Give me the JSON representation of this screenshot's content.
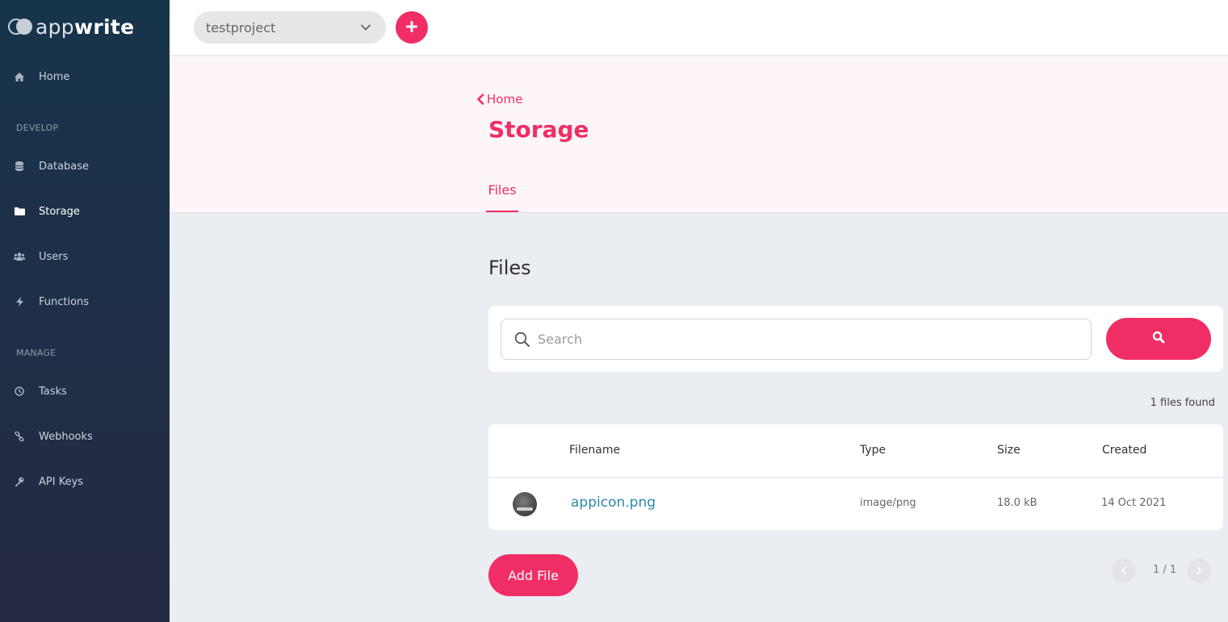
{
  "sidebar": {
    "logo": {
      "text_light": "app",
      "text_bold": "write"
    },
    "items": [
      {
        "label": "Home",
        "icon": "home-icon"
      },
      {
        "label": "Database",
        "icon": "database-icon"
      },
      {
        "label": "Storage",
        "icon": "folder-icon"
      },
      {
        "label": "Users",
        "icon": "users-icon"
      },
      {
        "label": "Functions",
        "icon": "bolt-icon"
      },
      {
        "label": "Tasks",
        "icon": "clock-icon"
      },
      {
        "label": "Webhooks",
        "icon": "link-icon"
      },
      {
        "label": "API Keys",
        "icon": "key-icon"
      }
    ],
    "sections": {
      "develop": "DEVELOP",
      "manage": "MANAGE"
    },
    "active": "Storage"
  },
  "header": {
    "project": "testproject"
  },
  "page": {
    "back_label": "Home",
    "title": "Storage",
    "tab": "Files"
  },
  "files": {
    "section_title": "Files",
    "search": {
      "placeholder": "Search"
    },
    "count_text": "1 files found",
    "columns": {
      "filename": "Filename",
      "type": "Type",
      "size": "Size",
      "created": "Created"
    },
    "rows": [
      {
        "filename": "appicon.png",
        "type": "image/png",
        "size": "18.0 kB",
        "created": "14 Oct 2021"
      }
    ],
    "add_label": "Add File",
    "pagination": "1 / 1"
  },
  "colors": {
    "accent": "#f02e65",
    "link": "#2b8aa8",
    "sidebar_top": "#16344a",
    "sidebar_bottom": "#262a42"
  }
}
